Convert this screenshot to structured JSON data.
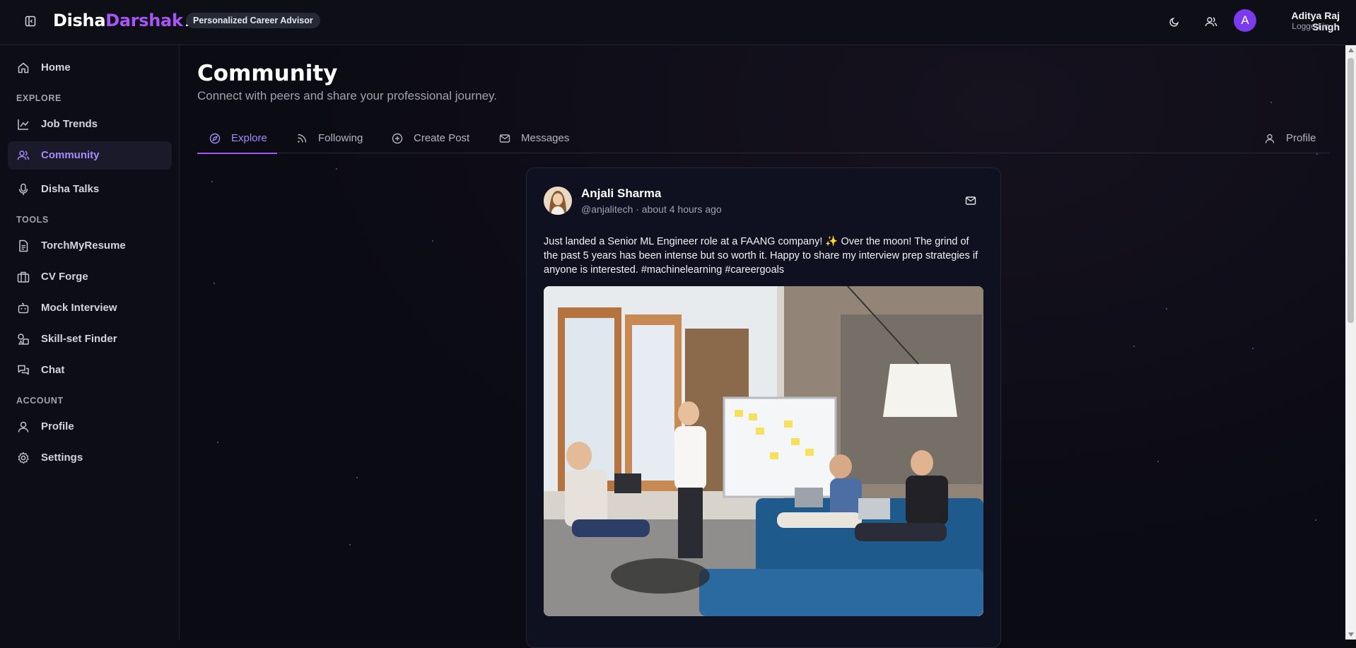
{
  "header": {
    "logo_part1": "Disha",
    "logo_part2": "Darshak",
    "logo_part3": "AI",
    "tagline": "Personalized Career Advisor",
    "user": {
      "avatar_initial": "A",
      "name": "Aditya Raj Singh",
      "status": "Logged in"
    },
    "icons": [
      "sidebar-toggle-icon",
      "moon-icon",
      "users-icon"
    ]
  },
  "sidebar": {
    "home": "Home",
    "sections": {
      "explore": "EXPLORE",
      "tools": "TOOLS",
      "account": "ACCOUNT"
    },
    "explore_items": [
      {
        "label": "Job Trends",
        "icon": "chart-line-icon"
      },
      {
        "label": "Community",
        "icon": "users-icon",
        "active": true
      },
      {
        "label": "Disha Talks",
        "icon": "microphone-icon"
      }
    ],
    "tool_items": [
      {
        "label": "TorchMyResume",
        "icon": "document-icon"
      },
      {
        "label": "CV Forge",
        "icon": "briefcase-icon"
      },
      {
        "label": "Mock Interview",
        "icon": "bot-icon"
      },
      {
        "label": "Skill-set Finder",
        "icon": "shapes-icon"
      },
      {
        "label": "Chat",
        "icon": "chat-icon"
      }
    ],
    "account_items": [
      {
        "label": "Profile",
        "icon": "user-icon"
      },
      {
        "label": "Settings",
        "icon": "gear-icon"
      }
    ],
    "accent_color": "#a855f7"
  },
  "main": {
    "title": "Community",
    "subtitle": "Connect with peers and share your professional journey.",
    "tabs": [
      {
        "label": "Explore",
        "icon": "compass-icon",
        "active": true
      },
      {
        "label": "Following",
        "icon": "rss-icon"
      },
      {
        "label": "Create Post",
        "icon": "plus-circle-icon"
      },
      {
        "label": "Messages",
        "icon": "mail-icon"
      },
      {
        "label": "Profile",
        "icon": "user-icon"
      }
    ]
  },
  "post": {
    "author_name": "Anjali Sharma",
    "author_meta": "@anjalitech · about 4 hours ago",
    "text": "Just landed a Senior ML Engineer role at a FAANG company! ✨ Over the moon! The grind of the past 5 years has been intense but so worth it. Happy to share my interview prep strategies if anyone is interested. #machinelearning #careergoals"
  }
}
